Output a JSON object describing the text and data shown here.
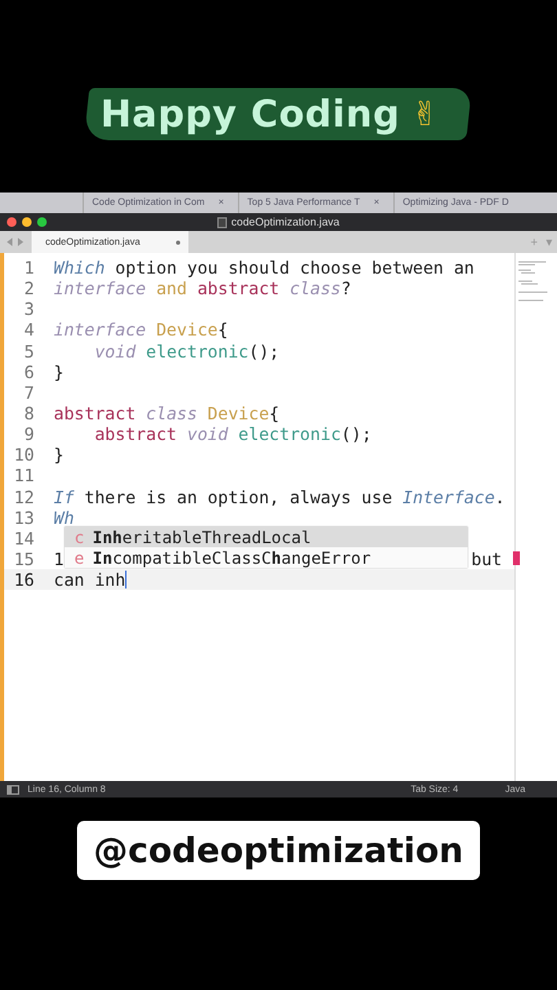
{
  "banner": {
    "title": "Happy Coding",
    "emoji": "✌"
  },
  "browser_tabs": [
    {
      "label": "Code Optimization in Com",
      "close": "×"
    },
    {
      "label": "Top 5 Java Performance T",
      "close": "×"
    },
    {
      "label": "Optimizing Java - PDF D"
    }
  ],
  "window": {
    "title": "codeOptimization.java"
  },
  "tab_bar": {
    "tabs": [
      {
        "label": "codeOptimization.java",
        "selected": true,
        "modified": true
      }
    ],
    "add": "+",
    "menu": "▾"
  },
  "editor": {
    "lines": [
      {
        "number": "1",
        "current": false,
        "tokens": [
          {
            "text": "Which",
            "kind": "emph"
          },
          {
            "text": " option you should choose between an",
            "kind": "plain"
          }
        ]
      },
      {
        "number": "2",
        "current": false,
        "tokens": [
          {
            "text": "interface",
            "kind": "storage"
          },
          {
            "text": " and",
            "kind": "name"
          },
          {
            "text": " abstract",
            "kind": "modifier"
          },
          {
            "text": " class",
            "kind": "storage"
          },
          {
            "text": "?",
            "kind": "plain"
          }
        ]
      },
      {
        "number": "3",
        "current": false
      },
      {
        "number": "4",
        "current": false,
        "tokens": [
          {
            "text": "interface",
            "kind": "storage"
          },
          {
            "text": " Device",
            "kind": "name"
          },
          {
            "text": "{",
            "kind": "plain"
          }
        ]
      },
      {
        "number": "5",
        "current": false,
        "tokens": [
          {
            "text": "    void",
            "kind": "storage"
          },
          {
            "text": " electronic",
            "kind": "func"
          },
          {
            "text": "();",
            "kind": "plain"
          }
        ]
      },
      {
        "number": "6",
        "current": false,
        "tokens": [
          {
            "text": "}",
            "kind": "plain"
          }
        ]
      },
      {
        "number": "7",
        "current": false
      },
      {
        "number": "8",
        "current": false,
        "tokens": [
          {
            "text": "abstract",
            "kind": "modifier"
          },
          {
            "text": " class",
            "kind": "storage"
          },
          {
            "text": " Device",
            "kind": "name"
          },
          {
            "text": "{",
            "kind": "plain"
          }
        ]
      },
      {
        "number": "9",
        "current": false,
        "tokens": [
          {
            "text": "    abstract",
            "kind": "modifier"
          },
          {
            "text": " void",
            "kind": "storage"
          },
          {
            "text": " electronic",
            "kind": "func"
          },
          {
            "text": "();",
            "kind": "plain"
          }
        ]
      },
      {
        "number": "10",
        "current": false,
        "tokens": [
          {
            "text": "}",
            "kind": "plain"
          }
        ]
      },
      {
        "number": "11",
        "current": false
      },
      {
        "number": "12",
        "current": false,
        "tokens": [
          {
            "text": "If",
            "kind": "emph"
          },
          {
            "text": " there is an option, always use",
            "kind": "plain"
          },
          {
            "text": " Interface",
            "kind": "emph"
          },
          {
            "text": ".",
            "kind": "plain"
          }
        ]
      },
      {
        "number": "13",
        "current": false,
        "tokens": [
          {
            "text": "Wh",
            "kind": "emph"
          }
        ]
      },
      {
        "number": "14",
        "current": false
      },
      {
        "number": "15",
        "current": false,
        "tokens": [
          {
            "text": "1",
            "kind": "plain"
          }
        ],
        "right_tokens": [
          {
            "text": "but",
            "kind": "plain"
          }
        ],
        "error_mark": true
      },
      {
        "number": "16",
        "current": true,
        "tokens": [
          {
            "text": "can inh",
            "kind": "plain"
          }
        ],
        "cursor": true
      }
    ]
  },
  "completions": [
    {
      "letter": "c",
      "text": "**Inh**eritableThreadLocal",
      "selected": true
    },
    {
      "letter": "e",
      "text": "**In**compatibleClassC**h**angeError",
      "selected": false
    }
  ],
  "status_bar": {
    "position": "Line 16, Column 8",
    "tab_size": "Tab Size: 4",
    "language": "Java"
  },
  "caption": "@codeoptimization"
}
